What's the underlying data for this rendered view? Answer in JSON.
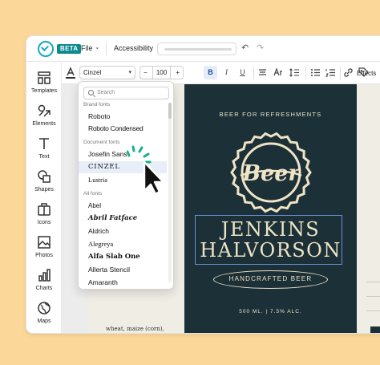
{
  "app": {
    "beta_badge": "BETA",
    "menu": {
      "file": "File",
      "accessibility": "Accessibility"
    },
    "title_field": {
      "value": ""
    }
  },
  "sidebar": {
    "items": [
      {
        "label": "Templates",
        "icon": "templates-icon"
      },
      {
        "label": "Elements",
        "icon": "elements-icon"
      },
      {
        "label": "Text",
        "icon": "text-icon"
      },
      {
        "label": "Shapes",
        "icon": "shapes-icon"
      },
      {
        "label": "Icons",
        "icon": "icons-icon"
      },
      {
        "label": "Photos",
        "icon": "photos-icon"
      },
      {
        "label": "Charts",
        "icon": "charts-icon"
      },
      {
        "label": "Maps",
        "icon": "maps-icon"
      }
    ]
  },
  "toolbar": {
    "font": "Cinzel",
    "size": "100",
    "minus": "−",
    "plus": "+",
    "bold": "B",
    "italic": "I",
    "underline": "U",
    "effects": "Effects"
  },
  "font_dropdown": {
    "search_placeholder": "Search",
    "sections": {
      "brand": "Brand fonts",
      "document": "Document fonts",
      "all": "All fonts"
    },
    "brand_fonts": [
      "Roboto",
      "Roboto Condensed"
    ],
    "document_fonts": [
      "Josefin Sans",
      "CINZEL",
      "Lustria"
    ],
    "selected": "CINZEL",
    "all_fonts": [
      "Abel",
      "Abril Fatface",
      "Aldrich",
      "Alegreya",
      "Alfa Slab One",
      "Allerta Stencil",
      "Amaranth"
    ]
  },
  "design": {
    "tagline": "BEER FOR REFRESHMENTS",
    "badge_word": "Beer",
    "name_line1": "JENKINS",
    "name_line2": "HALVORSON",
    "subtitle": "HANDCRAFTED BEER",
    "volume": "500 ML.  |  7.5% ALC.",
    "body_text": "wheat, maize (corn), rice, and oats are also used."
  },
  "colors": {
    "background": "#fbd89a",
    "accent": "#1aa6c0",
    "beta_badge": "#0c8a8f",
    "label_bg": "#1c3038",
    "label_text": "#efe4c6",
    "selection": "#6c8fd6"
  }
}
